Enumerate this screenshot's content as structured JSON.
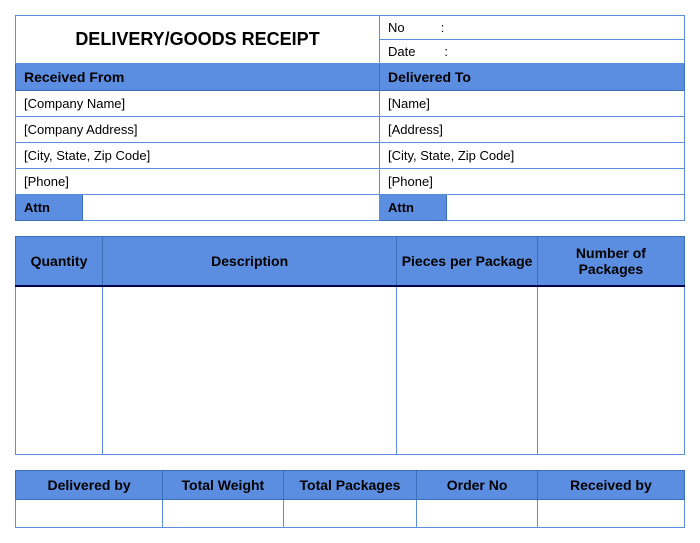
{
  "title": "DELIVERY/GOODS RECEIPT",
  "meta": {
    "no_label": "No",
    "date_label": "Date",
    "separator": ":"
  },
  "from": {
    "header": "Received From",
    "company": "[Company Name]",
    "address": "[Company Address]",
    "city": "[City, State, Zip Code]",
    "phone": "[Phone]",
    "attn_label": "Attn"
  },
  "to": {
    "header": "Delivered To",
    "name": "[Name]",
    "address": "[Address]",
    "city": "[City, State, Zip Code]",
    "phone": "[Phone]",
    "attn_label": "Attn"
  },
  "items": {
    "headers": {
      "quantity": "Quantity",
      "description": "Description",
      "pieces": "Pieces per Package",
      "packages": "Number of Packages"
    }
  },
  "footer": {
    "delivered_by": "Delivered by",
    "total_weight": "Total Weight",
    "total_packages": "Total Packages",
    "order_no": "Order No",
    "received_by": "Received by"
  }
}
